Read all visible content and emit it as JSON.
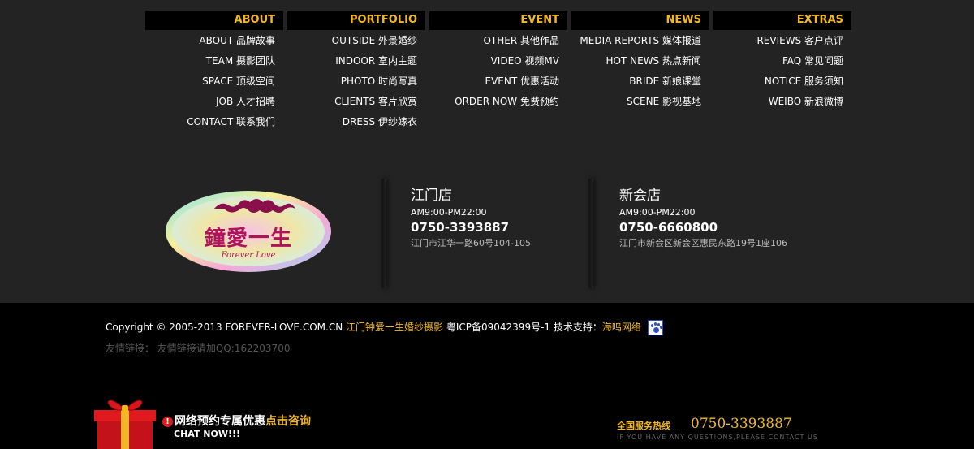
{
  "menu": {
    "columns": [
      {
        "title": "ABOUT",
        "items": [
          "ABOUT 品牌故事",
          "TEAM 摄影团队",
          "SPACE 顶级空间",
          "JOB 人才招聘",
          "CONTACT 联系我们"
        ]
      },
      {
        "title": "PORTFOLIO",
        "items": [
          "OUTSIDE 外景婚纱",
          "INDOOR 室内主题",
          "PHOTO 时尚写真",
          "CLIENTS 客片欣赏",
          "DRESS 伊纱嫁衣"
        ]
      },
      {
        "title": "EVENT",
        "items": [
          "OTHER 其他作品",
          "VIDEO 视频MV",
          "EVENT 优惠活动",
          "ORDER NOW 免费预约"
        ]
      },
      {
        "title": "NEWS",
        "items": [
          "MEDIA REPORTS 媒体报道",
          "HOT NEWS 热点新闻",
          "BRIDE 新娘课堂",
          "SCENE 影视基地"
        ]
      },
      {
        "title": "EXTRAS",
        "items": [
          "REVIEWS 客户点评",
          "FAQ 常见问题",
          "NOTICE 服务须知",
          "WEIBO 新浪微博"
        ]
      }
    ]
  },
  "logo": {
    "main": "鐘愛一生",
    "sub": "Forever Love"
  },
  "stores": [
    {
      "name": "江门店",
      "hours": "AM9:00-PM22:00",
      "phone": "0750-3393887",
      "address": "江门市江华一路60号104-105"
    },
    {
      "name": "新会店",
      "hours": "AM9:00-PM22:00",
      "phone": "0750-6660800",
      "address": "江门市新会区新会区惠民东路19号1座106"
    }
  ],
  "footer": {
    "copyright_prefix": "Copyright © 2005-2013 FOREVER-LOVE.COM.CN",
    "company_link": "江门钟爱一生婚纱摄影",
    "icp": "粤ICP备09042399号-1 技术支持：",
    "tech_link": "海鸣网络",
    "friend_links": "友情链接：  友情链接请加QQ:162203700"
  },
  "promo": {
    "alert": "!",
    "text": "网络预约专属优惠",
    "highlight": "点击咨询",
    "cta": "CHAT NOW!!!"
  },
  "hotline": {
    "label": "全国服务热线",
    "number": "0750-3393887",
    "sub": "IF YOU HAVE ANY QUESTIONS,PLEASE CONTACT US"
  },
  "colors": {
    "accent": "#f2b824",
    "background": "#232323",
    "band": "#000000"
  }
}
